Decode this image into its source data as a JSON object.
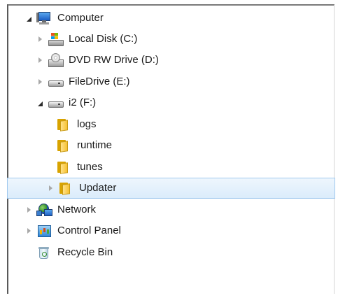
{
  "tree": {
    "items": [
      {
        "label": "Computer",
        "icon": "computer-icon",
        "expanded": true
      },
      {
        "label": "Local Disk (C:)",
        "icon": "local-disk-icon",
        "expanded": false
      },
      {
        "label": "DVD RW Drive (D:)",
        "icon": "dvd-drive-icon",
        "expanded": false
      },
      {
        "label": "FileDrive (E:)",
        "icon": "removable-drive-icon",
        "expanded": false
      },
      {
        "label": "i2 (F:)",
        "icon": "removable-drive-icon",
        "expanded": true
      },
      {
        "label": "logs",
        "icon": "folder-icon"
      },
      {
        "label": "runtime",
        "icon": "folder-icon"
      },
      {
        "label": "tunes",
        "icon": "folder-icon"
      },
      {
        "label": "Updater",
        "icon": "folder-icon",
        "expanded": false,
        "selected": true
      },
      {
        "label": "Network",
        "icon": "network-icon",
        "expanded": false
      },
      {
        "label": "Control Panel",
        "icon": "control-panel-icon",
        "expanded": false
      },
      {
        "label": "Recycle Bin",
        "icon": "recycle-bin-icon"
      }
    ]
  },
  "colors": {
    "selection_bg": "#dbecfb",
    "selection_border": "#9fc8ee",
    "text": "#1a1a1a"
  }
}
